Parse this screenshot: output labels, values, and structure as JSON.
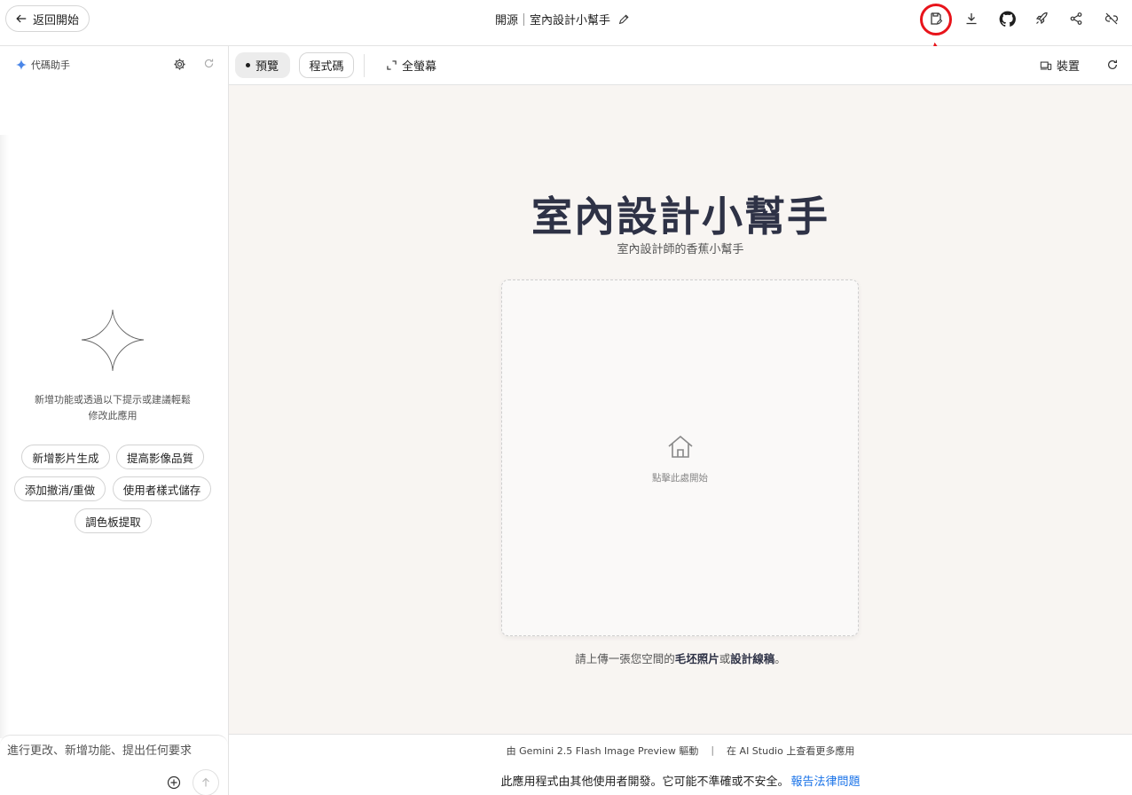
{
  "header": {
    "back_label": "返回開始",
    "breadcrumb_prefix": "開源",
    "app_name": "室內設計小幫手"
  },
  "sidebar": {
    "assistant_label": "代碼助手",
    "hint_line1": "新增功能或透過以下提示或建議輕鬆",
    "hint_line2": "修改此應用",
    "suggestions": [
      "新增影片生成",
      "提高影像品質",
      "添加撤消/重做",
      "使用者樣式儲存",
      "調色板提取"
    ],
    "input_placeholder": "進行更改、新增功能、提出任何要求"
  },
  "toolbar": {
    "preview_label": "預覽",
    "code_label": "程式碼",
    "fullscreen_label": "全螢幕",
    "device_label": "裝置"
  },
  "preview": {
    "title": "室內設計小幫手",
    "subtitle": "室內設計師的香蕉小幫手",
    "upload_text": "點擊此處開始",
    "hint_before": "請上傳一張您空間的",
    "hint_bold1": "毛坯照片",
    "hint_middle": "或",
    "hint_bold2": "設計線稿",
    "hint_after": "。"
  },
  "footer": {
    "powered_by": "由 Gemini 2.5 Flash Image Preview 驅動",
    "separator": "|",
    "more_apps": "在 AI Studio 上查看更多應用",
    "disclaimer": "此應用程式由其他使用者開發。它可能不準確或不安全。",
    "report_link": "報告法律問題"
  },
  "colors": {
    "accent_blue": "#1a73e8",
    "annotation_red": "#e8141b",
    "title_navy": "#2e3246",
    "preview_bg": "#f8f5f2"
  },
  "icons": [
    "arrow-left-icon",
    "pencil-icon",
    "save-draft-icon",
    "download-icon",
    "github-icon",
    "rocket-icon",
    "share-icon",
    "link-off-icon",
    "sparkle-icon",
    "gear-icon",
    "refresh-icon",
    "add-circle-icon",
    "arrow-up-icon",
    "fullscreen-icon",
    "devices-icon",
    "home-icon"
  ]
}
